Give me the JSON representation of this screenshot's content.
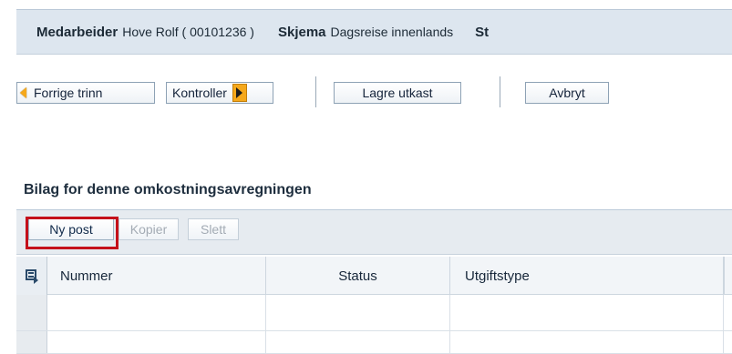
{
  "header": {
    "employee_label": "Medarbeider",
    "employee_value": "Hove Rolf ( 00101236 )",
    "form_label": "Skjema",
    "form_value": "Dagsreise innenlands",
    "status_label": "St"
  },
  "toolbar": {
    "prev_step": "Forrige trinn",
    "check": "Kontroller",
    "save_draft": "Lagre utkast",
    "cancel": "Avbryt"
  },
  "section": {
    "title": "Bilag for denne omkostningsavregningen"
  },
  "table_toolbar": {
    "new_entry": "Ny post",
    "copy": "Kopier",
    "delete": "Slett"
  },
  "table": {
    "columns": [
      "Nummer",
      "Status",
      "Utgiftstype"
    ],
    "rows": [
      [
        "",
        "",
        ""
      ],
      [
        "",
        "",
        ""
      ]
    ]
  },
  "icons": {
    "prev_arrow": "arrow-left-icon",
    "next_arrow": "arrow-right-icon",
    "select_all": "table-select-icon"
  },
  "colors": {
    "header_bg": "#dde6ef",
    "accent_orange": "#f5a81c",
    "highlight_red": "#c4101a"
  }
}
